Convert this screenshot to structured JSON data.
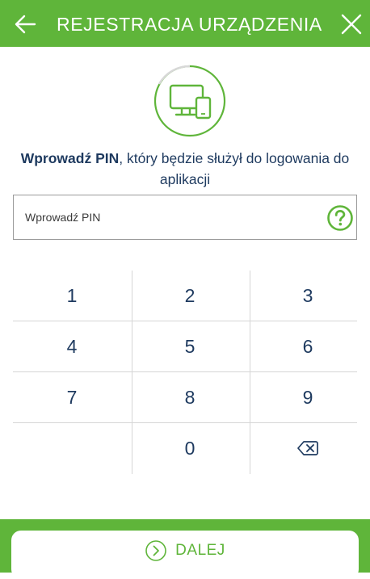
{
  "header": {
    "title": "REJESTRACJA URZĄDZENIA",
    "back_icon": "arrow-left-icon",
    "close_icon": "close-icon"
  },
  "device_icon": "desktop-and-phone-icon",
  "prompt": {
    "bold": "Wprowadź PIN",
    "rest": ", który będzie służył do logowania do aplikacji"
  },
  "pin_field": {
    "placeholder": "Wprowadź PIN",
    "value": "",
    "help_icon": "question-mark-icon"
  },
  "keypad": {
    "keys": [
      "1",
      "2",
      "3",
      "4",
      "5",
      "6",
      "7",
      "8",
      "9",
      "",
      "0",
      "backspace"
    ],
    "backspace_icon": "backspace-icon"
  },
  "next_button": {
    "label": "DALEJ",
    "icon": "chevron-right-circle-icon"
  },
  "colors": {
    "accent": "#5fb53a",
    "text": "#1e3a5f",
    "divider": "#d6d6d6"
  }
}
